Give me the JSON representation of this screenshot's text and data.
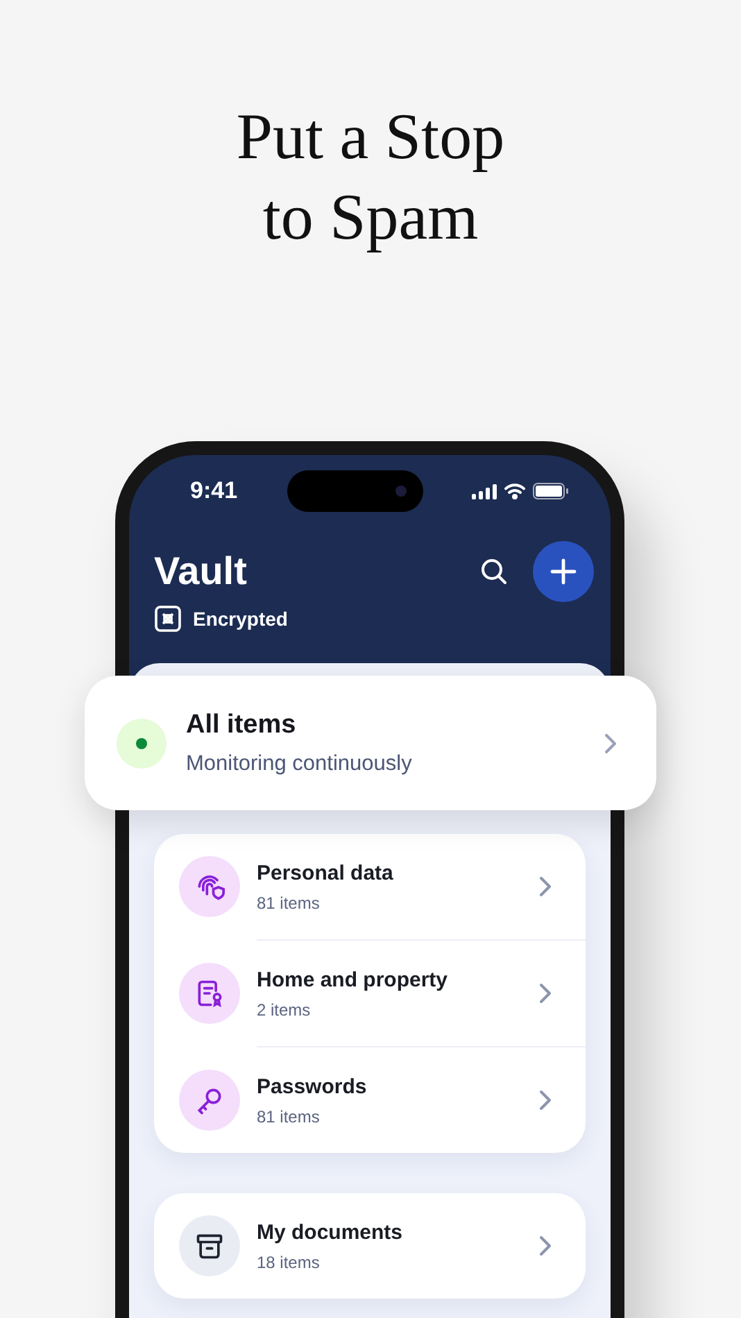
{
  "headline": {
    "lines": [
      "Put a Stop",
      "to Spam"
    ]
  },
  "status_bar": {
    "time": "9:41"
  },
  "header": {
    "title": "Vault",
    "badge": "Encrypted"
  },
  "summary_card": {
    "title": "All items",
    "status": "Monitoring continuously",
    "color": "#0b8a3a"
  },
  "groups": [
    {
      "rows": [
        {
          "kind": "fingerprint",
          "title": "Personal data",
          "count": "81 items"
        },
        {
          "kind": "certificate",
          "title": "Home and property",
          "count": "2 items"
        },
        {
          "kind": "key",
          "title": "Passwords",
          "count": "81 items"
        }
      ]
    },
    {
      "rows": [
        {
          "kind": "archive",
          "title": "My documents",
          "count": "18 items"
        }
      ]
    }
  ]
}
